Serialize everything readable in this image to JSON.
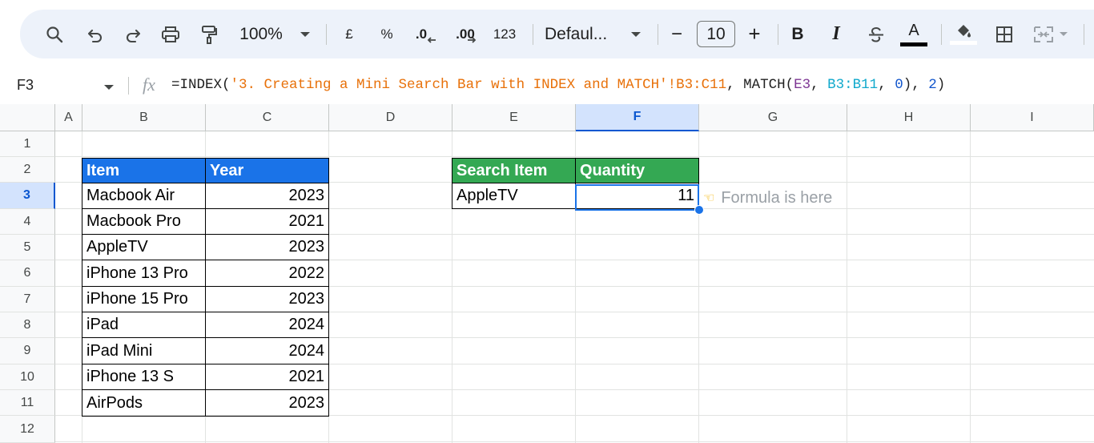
{
  "toolbar": {
    "zoom": "100%",
    "currency": "£",
    "percent": "%",
    "decimal_decrease": ".0",
    "decimal_increase": ".00",
    "number_format": "123",
    "font": "Defaul...",
    "font_size": "10",
    "minus": "−",
    "plus": "+",
    "bold": "B",
    "italic": "I",
    "text_color": "A",
    "icons": [
      "search-icon",
      "undo-icon",
      "redo-icon",
      "print-icon",
      "paint-format-icon",
      "zoom-dropdown-icon",
      "decrease-decimal-icon",
      "increase-decimal-icon",
      "font-dropdown-icon",
      "bold-icon",
      "italic-icon",
      "strikethrough-icon",
      "text-color-icon",
      "fill-color-icon",
      "borders-icon",
      "merge-cells-icon"
    ]
  },
  "formula_bar": {
    "cell_ref": "F3",
    "fx": "fx",
    "parts": {
      "p1": "=INDEX(",
      "p2": "'3. Creating a Mini Search Bar with INDEX and MATCH'!B3:C11",
      "p3": ", MATCH(",
      "p4": "E3",
      "p5": ", ",
      "p6": "B3:B11",
      "p7": ", ",
      "p8": "0",
      "p9": "), ",
      "p10": "2",
      "p11": ")"
    }
  },
  "columns": [
    "A",
    "B",
    "C",
    "D",
    "E",
    "F",
    "G",
    "H",
    "I"
  ],
  "rows": [
    "1",
    "2",
    "3",
    "4",
    "5",
    "6",
    "7",
    "8",
    "9",
    "10",
    "11",
    "12"
  ],
  "items_table": {
    "headers": [
      "Item",
      "Year"
    ],
    "rows": [
      [
        "Macbook Air",
        "2023"
      ],
      [
        "Macbook Pro",
        "2021"
      ],
      [
        "AppleTV",
        "2023"
      ],
      [
        "iPhone 13 Pro",
        "2022"
      ],
      [
        "iPhone 15 Pro",
        "2023"
      ],
      [
        "iPad",
        "2024"
      ],
      [
        "iPad Mini",
        "2024"
      ],
      [
        "iPhone 13 S",
        "2021"
      ],
      [
        "AirPods",
        "2023"
      ]
    ]
  },
  "search_table": {
    "headers": [
      "Search Item",
      "Quantity"
    ],
    "search_value": "AppleTV",
    "result": "11"
  },
  "note": "Formula is here",
  "colors": {
    "blue_header": "#1a73e8",
    "green_header": "#34a853",
    "selection": "#1a73e8"
  }
}
